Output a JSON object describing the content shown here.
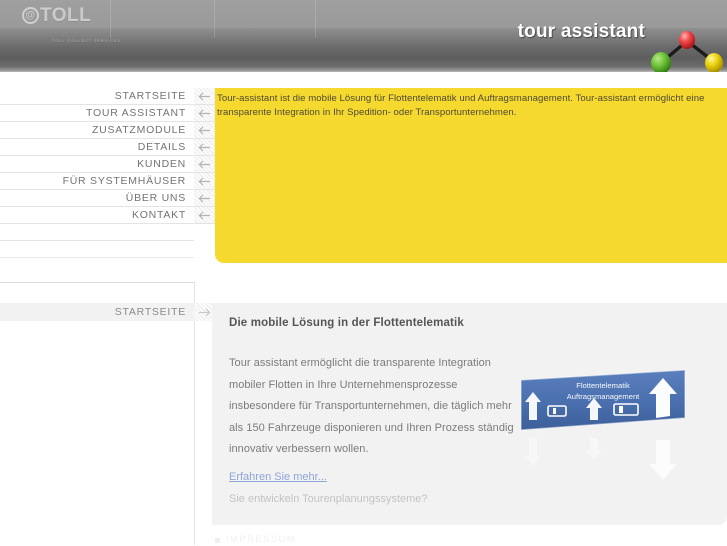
{
  "header": {
    "logo_text": "TOLL",
    "logo_at": "@",
    "logo_subtitle": "TOLL COLLECT SERVICES",
    "title": "tour assistant",
    "tab_divider_count": 3,
    "logo_icon": "molecule-icon",
    "node_colors": {
      "green": "#5cb32a",
      "red": "#f2484a",
      "yellow": "#edd411"
    }
  },
  "sidebar": {
    "items": [
      {
        "label": "STARTSEITE",
        "icon": "arrow-left-icon"
      },
      {
        "label": "TOUR ASSISTANT",
        "icon": "arrow-left-icon"
      },
      {
        "label": "ZUSATZMODULE",
        "icon": "arrow-left-icon"
      },
      {
        "label": "DETAILS",
        "icon": "arrow-left-icon"
      },
      {
        "label": "KUNDEN",
        "icon": "arrow-left-icon"
      },
      {
        "label": "FÜR SYSTEMHÄUSER",
        "icon": "arrow-left-icon"
      },
      {
        "label": "ÜBER UNS",
        "icon": "arrow-left-icon"
      },
      {
        "label": "KONTAKT",
        "icon": "arrow-left-icon"
      }
    ]
  },
  "breadcrumb": {
    "label": "STARTSEITE",
    "icon": "arrow-right-icon"
  },
  "intro": {
    "text": "Tour-assistant ist die mobile Lösung für Flottentelematik und Auftragsmanagement. Tour-assistant ermöglicht eine transparente Integration in Ihr Spedition- oder Transportunternehmen.",
    "background_color": "#f6d92e"
  },
  "content": {
    "title": "Die mobile Lösung in der Flottentelematik",
    "body": "Tour assistant ermöglicht die transparente Integration mobiler Flotten in Ihre Unternehmensprozesse insbesondere für Transportunternehmen, die täglich mehr als 150 Fahrzeuge disponieren und Ihren Prozess ständig innovativ verbessern wollen.",
    "link_label": "Erfahren Sie mehr...",
    "link_color": "#8fa4d8",
    "subtext": "Sie entwickeln Tourenplanungssysteme?",
    "image": {
      "name": "roadsign-image",
      "line1": "Flottentelematik",
      "line2": "Auftragsmanagement",
      "background_color": "#4a6fae"
    }
  },
  "footer": {
    "imprint_label": "IMPRESSUM",
    "bullet_icon": "square-bullet-icon"
  }
}
